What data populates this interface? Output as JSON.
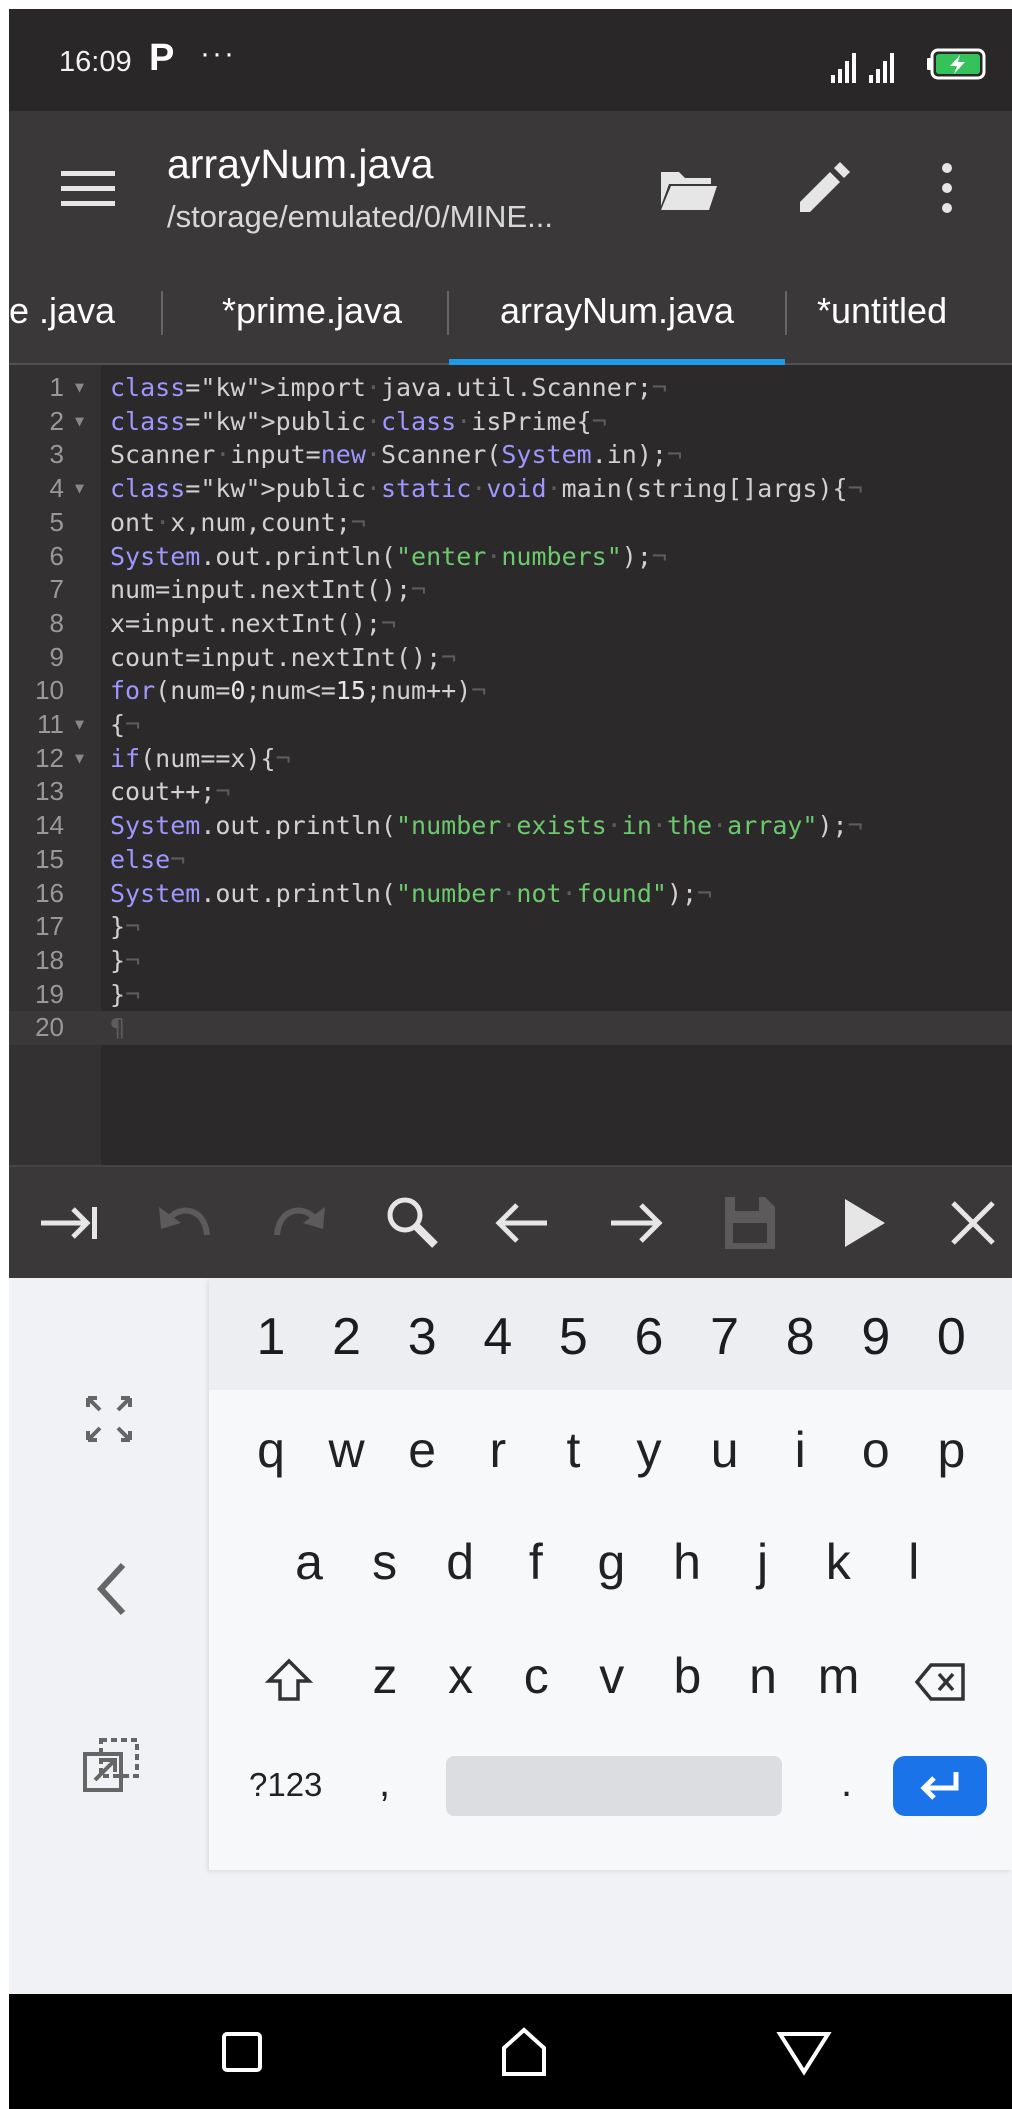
{
  "status_bar": {
    "time": "16:09",
    "app_indicator": "P",
    "more": "···",
    "signal_icon": "signal-bars-icon",
    "battery_icon": "battery-charging-icon"
  },
  "toolbar": {
    "menu_icon": "menu-icon",
    "title": "arrayNum.java",
    "path": "/storage/emulated/0/MINE...",
    "folder_icon": "folder-open-icon",
    "edit_icon": "pencil-icon",
    "more_icon": "more-vertical-icon"
  },
  "tabs": [
    {
      "label": "e .java",
      "active": false
    },
    {
      "label": "*prime.java",
      "active": false
    },
    {
      "label": "arrayNum.java",
      "active": true
    },
    {
      "label": "*untitled",
      "active": false
    }
  ],
  "editor": {
    "current_line": 20,
    "lines": [
      {
        "n": "1",
        "fold": true,
        "text": "import·java.util.Scanner;¬"
      },
      {
        "n": "2",
        "fold": true,
        "text": "public·class·isPrime{¬"
      },
      {
        "n": "3",
        "fold": false,
        "text": "Scanner·input=new·Scanner(System.in);¬"
      },
      {
        "n": "4",
        "fold": true,
        "text": "public·static·void·main(string[]args){¬"
      },
      {
        "n": "5",
        "fold": false,
        "text": "ont·x,num,count;¬"
      },
      {
        "n": "6",
        "fold": false,
        "text": "System.out.println(\"enter·numbers\");¬"
      },
      {
        "n": "7",
        "fold": false,
        "text": "num=input.nextInt();¬"
      },
      {
        "n": "8",
        "fold": false,
        "text": "x=input.nextInt();¬"
      },
      {
        "n": "9",
        "fold": false,
        "text": "count=input.nextInt();¬"
      },
      {
        "n": "10",
        "fold": false,
        "text": "for(num=0;num<=15;num++)¬"
      },
      {
        "n": "11",
        "fold": true,
        "text": "{¬"
      },
      {
        "n": "12",
        "fold": true,
        "text": "if(num==x){¬"
      },
      {
        "n": "13",
        "fold": false,
        "text": "cout++;¬"
      },
      {
        "n": "14",
        "fold": false,
        "text": "System.out.println(\"number·exists·in·the·array\");¬"
      },
      {
        "n": "15",
        "fold": false,
        "text": "else¬"
      },
      {
        "n": "16",
        "fold": false,
        "text": "System.out.println(\"number·not·found\");¬"
      },
      {
        "n": "17",
        "fold": false,
        "text": "}¬"
      },
      {
        "n": "18",
        "fold": false,
        "text": "}¬"
      },
      {
        "n": "19",
        "fold": false,
        "text": "}¬"
      },
      {
        "n": "20",
        "fold": false,
        "text": "¶"
      }
    ]
  },
  "actions": [
    {
      "name": "tab-indent-icon"
    },
    {
      "name": "undo-icon"
    },
    {
      "name": "redo-icon"
    },
    {
      "name": "search-icon"
    },
    {
      "name": "arrow-left-icon"
    },
    {
      "name": "arrow-right-icon"
    },
    {
      "name": "save-icon"
    },
    {
      "name": "run-icon"
    },
    {
      "name": "close-icon"
    }
  ],
  "keyboard": {
    "number_row": [
      "1",
      "2",
      "3",
      "4",
      "5",
      "6",
      "7",
      "8",
      "9",
      "0"
    ],
    "row1": [
      "q",
      "w",
      "e",
      "r",
      "t",
      "y",
      "u",
      "i",
      "o",
      "p"
    ],
    "row2": [
      "a",
      "s",
      "d",
      "f",
      "g",
      "h",
      "j",
      "k",
      "l"
    ],
    "row3": [
      "z",
      "x",
      "c",
      "v",
      "b",
      "n",
      "m"
    ],
    "symbols_key": "?123",
    "comma_key": ",",
    "period_key": ".",
    "side_icons": [
      "expand-icon",
      "chevron-left-icon",
      "floating-keyboard-icon"
    ]
  },
  "navbar": {
    "buttons": [
      "recents-square-icon",
      "home-icon",
      "back-triangle-icon"
    ]
  },
  "colors": {
    "accent": "#1e9be8",
    "keyword": "#9d97ff",
    "string": "#6cc96e",
    "enter_key": "#1a73e8"
  }
}
